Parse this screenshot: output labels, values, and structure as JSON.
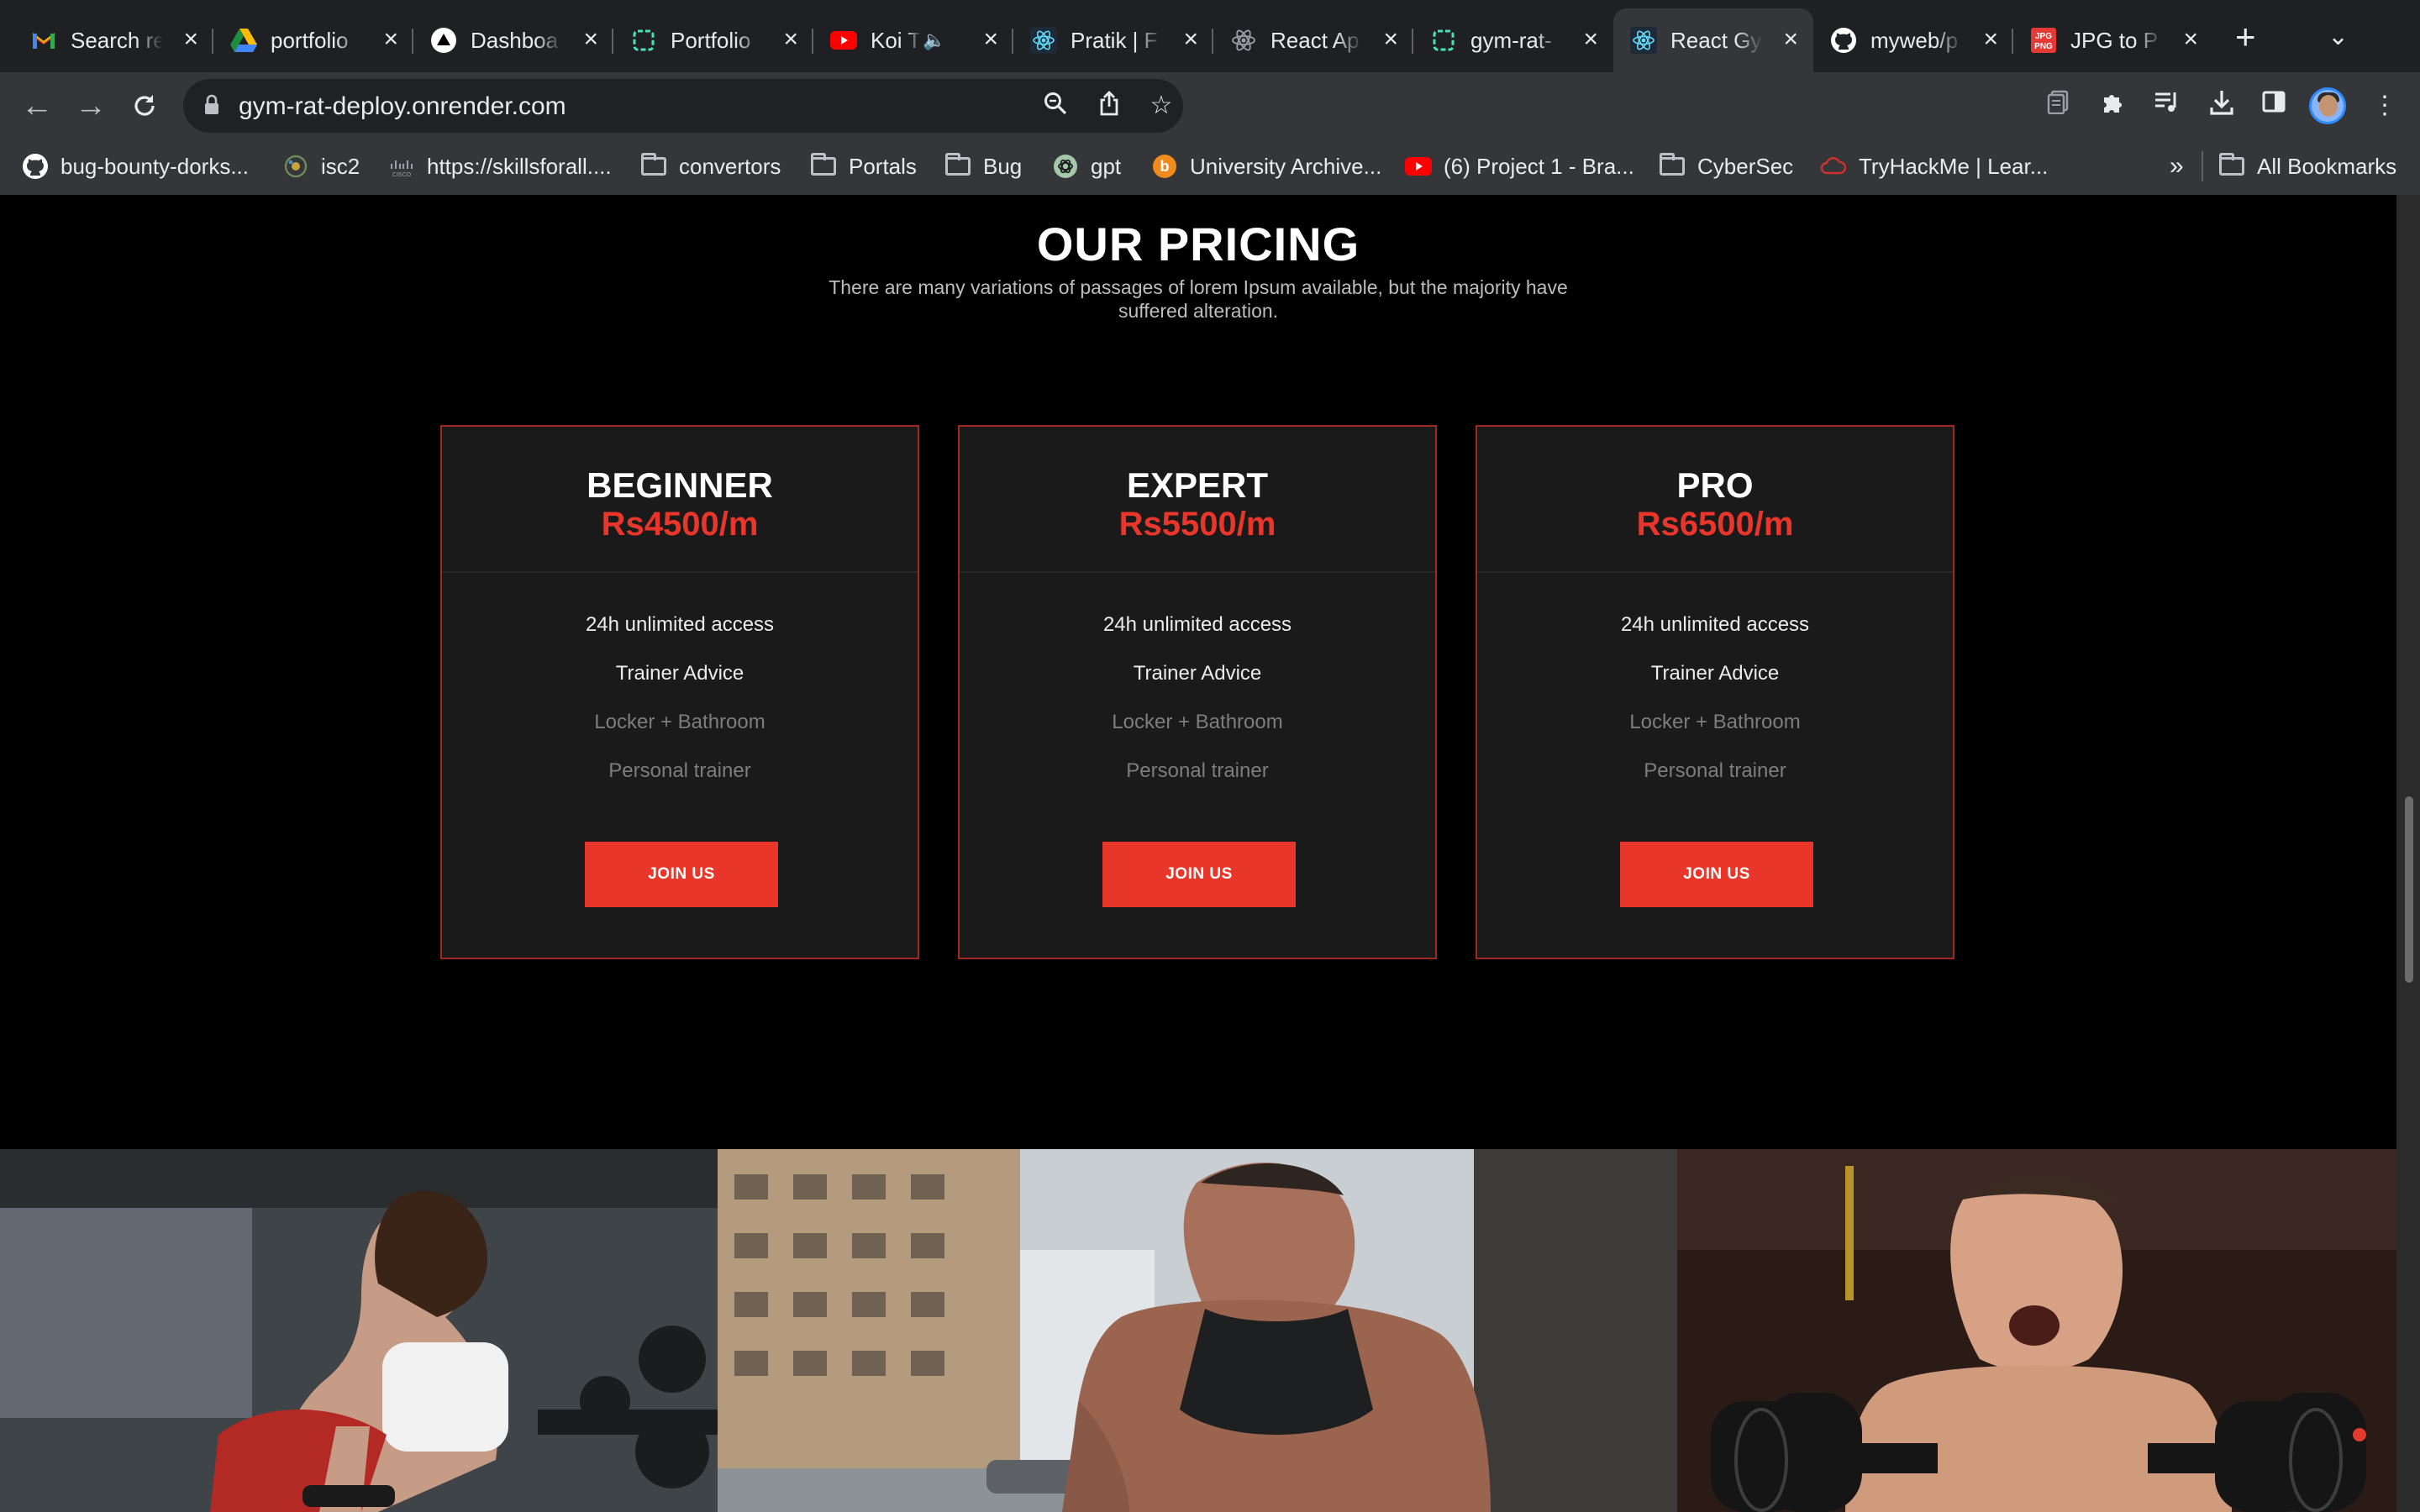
{
  "browser": {
    "tabs": [
      {
        "title": "Search re",
        "icon": "gmail-icon"
      },
      {
        "title": "portfolio",
        "icon": "google-drive-icon"
      },
      {
        "title": "Dashboa",
        "icon": "vercel-icon"
      },
      {
        "title": "Portfolio",
        "icon": "render-icon"
      },
      {
        "title": "Koi T",
        "icon": "youtube-icon"
      },
      {
        "title": "Pratik | F",
        "icon": "react-icon"
      },
      {
        "title": "React Ap",
        "icon": "react-icon"
      },
      {
        "title": "gym-rat-",
        "icon": "render-icon"
      },
      {
        "title": "React Gy",
        "icon": "react-icon"
      },
      {
        "title": "myweb/p",
        "icon": "github-icon"
      },
      {
        "title": "JPG to P",
        "icon": "jpg-png-icon"
      }
    ],
    "active_tab_index": 8,
    "url": "gym-rat-deploy.onrender.com",
    "bookmarks": [
      {
        "label": "bug-bounty-dorks...",
        "icon": "github-icon"
      },
      {
        "label": "isc2",
        "icon": "isc2-icon"
      },
      {
        "label": "https://skillsforall....",
        "icon": "cisco-icon"
      },
      {
        "label": "convertors",
        "icon": "folder-icon"
      },
      {
        "label": "Portals",
        "icon": "folder-icon"
      },
      {
        "label": "Bug",
        "icon": "folder-icon"
      },
      {
        "label": "gpt",
        "icon": "openai-icon"
      },
      {
        "label": "University Archive...",
        "icon": "b-icon"
      },
      {
        "label": "(6) Project 1 - Bra...",
        "icon": "youtube-icon"
      },
      {
        "label": "CyberSec",
        "icon": "folder-icon"
      },
      {
        "label": "TryHackMe | Lear...",
        "icon": "tryhackme-icon"
      }
    ],
    "bookmarks_overflow": "»",
    "all_bookmarks": "All Bookmarks"
  },
  "pricing": {
    "title": "OUR PRICING",
    "subtitle": "There are many variations of passages of lorem Ipsum available, but the majority have suffered alteration.",
    "plans": [
      {
        "name": "BEGINNER",
        "price": "Rs4500/m",
        "features": [
          {
            "label": "24h unlimited access",
            "included": true
          },
          {
            "label": "Trainer Advice",
            "included": true
          },
          {
            "label": "Locker + Bathroom",
            "included": false
          },
          {
            "label": "Personal trainer",
            "included": false
          }
        ],
        "cta": "JOIN US"
      },
      {
        "name": "EXPERT",
        "price": "Rs5500/m",
        "features": [
          {
            "label": "24h unlimited access",
            "included": true
          },
          {
            "label": "Trainer Advice",
            "included": true
          },
          {
            "label": "Locker + Bathroom",
            "included": false
          },
          {
            "label": "Personal trainer",
            "included": false
          }
        ],
        "cta": "JOIN US"
      },
      {
        "name": "PRO",
        "price": "Rs6500/m",
        "features": [
          {
            "label": "24h unlimited access",
            "included": true
          },
          {
            "label": "Trainer Advice",
            "included": true
          },
          {
            "label": "Locker + Bathroom",
            "included": false
          },
          {
            "label": "Personal trainer",
            "included": false
          }
        ],
        "cta": "JOIN US"
      }
    ]
  },
  "gallery": [
    {
      "subject": "woman doing dumbbell row"
    },
    {
      "subject": "man lifting outdoors"
    },
    {
      "subject": "man shouting with dumbbells"
    }
  ],
  "colors": {
    "accent": "#e8362a",
    "card_bg": "#1a1a1a",
    "card_border": "#9c2a22",
    "page_bg": "#000000"
  }
}
